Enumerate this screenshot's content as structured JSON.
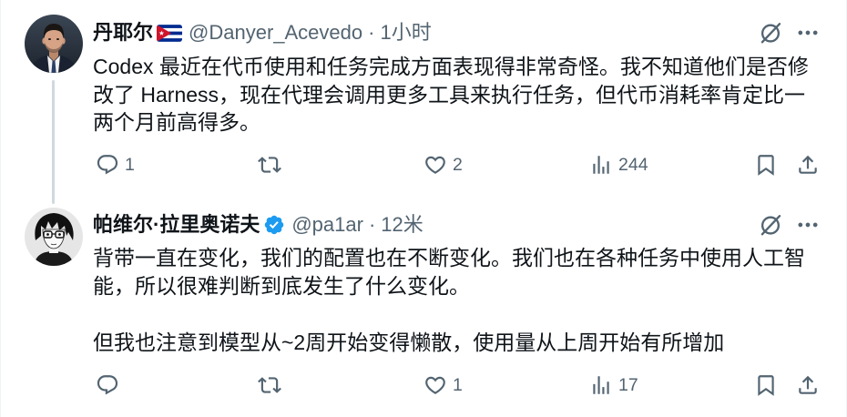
{
  "tweets": [
    {
      "author": {
        "name": "丹耶尔",
        "handle": "@Danyer_Acevedo",
        "badge_icon": "cuba-flag-icon"
      },
      "separator": "·",
      "time": "1小时",
      "paragraphs": [
        "Codex 最近在代币使用和任务完成方面表现得非常奇怪。我不知道他们是否修改了 Harness，现在代理会调用更多工具来执行任务，但代币消耗率肯定比一两个月前高得多。"
      ],
      "actions": {
        "reply": "1",
        "like": "2",
        "views": "244"
      }
    },
    {
      "author": {
        "name": "帕维尔·拉里奥诺夫",
        "handle": "@pa1ar",
        "badge_icon": "verified-badge-icon"
      },
      "separator": "·",
      "time": "12米",
      "paragraphs": [
        "背带一直在变化，我们的配置也在不断变化。我们也在各种任务中使用人工智能，所以很难判断到底发生了什么变化。",
        "但我也注意到模型从~2周开始变得懒散，使用量从上周开始有所增加"
      ],
      "actions": {
        "like": "1",
        "views": "17"
      }
    }
  ],
  "icons": {
    "header": [
      "grok-icon",
      "more-icon"
    ],
    "actions": [
      "reply-icon",
      "retweet-icon",
      "like-icon",
      "views-icon",
      "bookmark-icon",
      "share-icon"
    ]
  },
  "colors": {
    "text": "#0f1419",
    "secondary": "#536471",
    "line": "#cfd9de",
    "verified": "#1d9bf0",
    "border": "#eff3f4",
    "bg": "#ffffff"
  }
}
